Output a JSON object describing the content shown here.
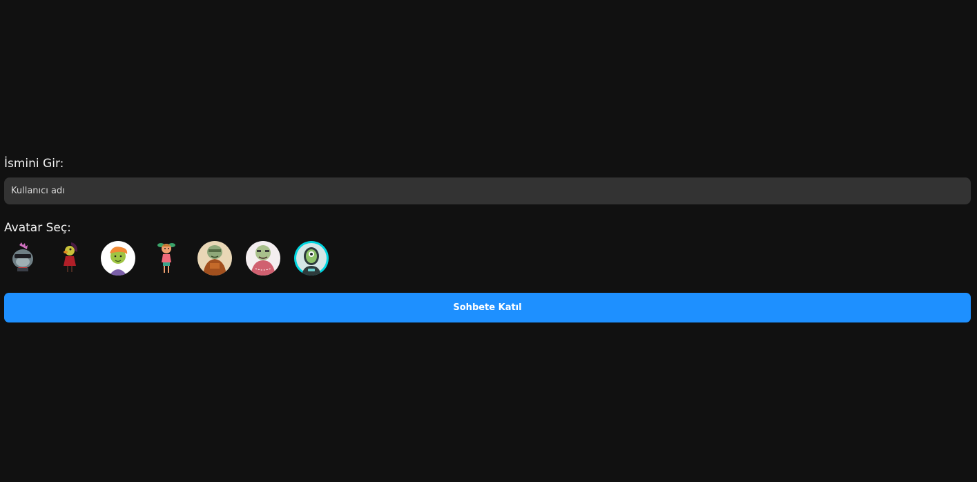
{
  "form": {
    "name_label": "İsmini Gir:",
    "name_placeholder": "Kullanıcı adı",
    "name_value": "",
    "avatar_label": "Avatar Seç:",
    "join_label": "Sohbete Katıl"
  },
  "avatars": [
    {
      "icon": "punk-cat-avatar-icon"
    },
    {
      "icon": "chicken-girl-avatar-icon"
    },
    {
      "icon": "orange-hair-boy-avatar-icon"
    },
    {
      "icon": "pigtail-girl-avatar-icon"
    },
    {
      "icon": "green-orc-brown-avatar-icon"
    },
    {
      "icon": "zombie-pink-avatar-icon"
    },
    {
      "icon": "cyclops-astronaut-avatar-icon"
    }
  ],
  "colors": {
    "background": "#111111",
    "input_bg": "#333333",
    "accent": "#1e90ff",
    "selected_ring": "#00d5e0"
  }
}
